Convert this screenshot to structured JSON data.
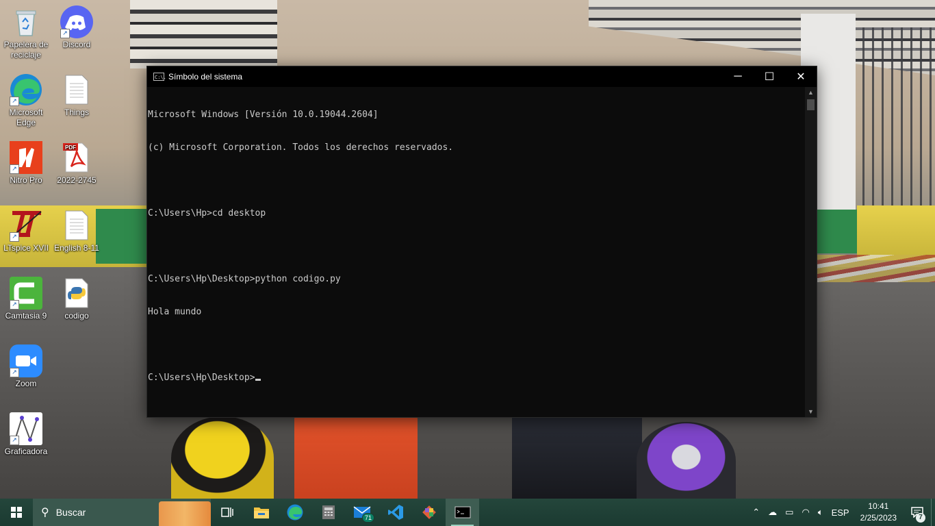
{
  "desktop": {
    "icons": [
      {
        "label": "Papelera de reciclaje",
        "icon": "recycle-bin-icon"
      },
      {
        "label": "Discord",
        "icon": "discord-icon"
      },
      {
        "label": "Microsoft Edge",
        "icon": "edge-icon"
      },
      {
        "label": "Things",
        "icon": "document-icon"
      },
      {
        "label": "Nitro Pro",
        "icon": "nitro-pro-icon"
      },
      {
        "label": "2022-2745",
        "icon": "pdf-icon"
      },
      {
        "label": "LTspice XVII",
        "icon": "ltspice-icon"
      },
      {
        "label": "English 8-11",
        "icon": "document-icon"
      },
      {
        "label": "Camtasia 9",
        "icon": "camtasia-icon"
      },
      {
        "label": "codigo",
        "icon": "python-file-icon"
      },
      {
        "label": "Zoom",
        "icon": "zoom-icon"
      },
      {
        "label": "Graficadora",
        "icon": "graficadora-icon"
      }
    ]
  },
  "window": {
    "title": "Símbolo del sistema",
    "icon_text": "C:\\.",
    "controls": {
      "minimize": "─",
      "maximize": "☐",
      "close": "✕"
    },
    "lines": [
      "Microsoft Windows [Versión 10.0.19044.2604]",
      "(c) Microsoft Corporation. Todos los derechos reservados.",
      "",
      "C:\\Users\\Hp>cd desktop",
      "",
      "C:\\Users\\Hp\\Desktop>python codigo.py",
      "Hola mundo",
      "",
      "C:\\Users\\Hp\\Desktop>"
    ]
  },
  "taskbar": {
    "search_placeholder": "Buscar",
    "apps": [
      {
        "icon": "task-view-icon"
      },
      {
        "icon": "file-explorer-icon"
      },
      {
        "icon": "edge-icon"
      },
      {
        "icon": "calculator-icon"
      },
      {
        "icon": "mail-icon",
        "badge": "71"
      },
      {
        "icon": "vscode-icon"
      },
      {
        "icon": "git-gui-icon"
      },
      {
        "icon": "command-prompt-icon"
      }
    ],
    "tray": {
      "language": "ESP",
      "time": "10:41",
      "date": "2/25/2023",
      "notifications": "7"
    }
  }
}
